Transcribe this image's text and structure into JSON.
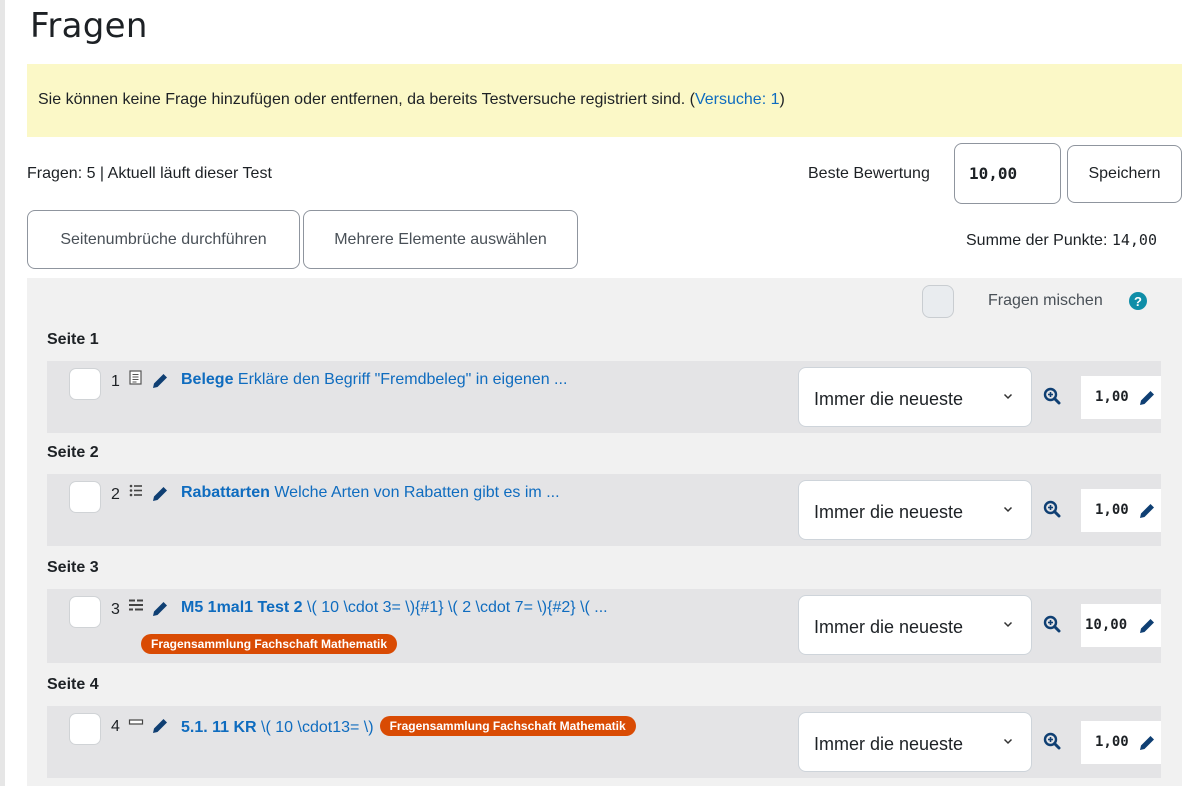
{
  "page": {
    "title": "Fragen"
  },
  "alert": {
    "text": "Sie können keine Frage hinzufügen oder entfernen, da bereits Testversuche registriert sind. (",
    "link": "Versuche: 1",
    "end": ")"
  },
  "status": "Fragen: 5 | Aktuell läuft dieser Test",
  "best_grade": {
    "label": "Beste Bewertung",
    "value": "10,00",
    "save_label": "Speichern"
  },
  "buttons": {
    "repaginate": "Seitenumbrüche durchführen",
    "multiselect": "Mehrere Elemente auswählen"
  },
  "total": {
    "label": "Summe der Punkte: ",
    "value": "14,00"
  },
  "shuffle": {
    "label": "Fragen mischen",
    "help": "?"
  },
  "pages": [
    {
      "label": "Seite 1",
      "slot": {
        "number": "1",
        "icon": "essay-question-icon",
        "name": "Belege",
        "text": " Erkläre den Begriff \"Fremdbeleg\" in eigenen ...",
        "tag": "",
        "version": "Immer die neueste",
        "mark": "1,00"
      }
    },
    {
      "label": "Seite 2",
      "slot": {
        "number": "2",
        "icon": "multichoice-question-icon",
        "name": "Rabattarten",
        "text": " Welche Arten von Rabatten gibt es im ...",
        "tag": "",
        "version": "Immer die neueste",
        "mark": "1,00"
      }
    },
    {
      "label": "Seite 3",
      "slot": {
        "number": "3",
        "icon": "cloze-question-icon",
        "name": "M5 1mal1 Test 2",
        "text": " \\( 10 \\cdot 3= \\){#1} \\( 2 \\cdot 7= \\){#2} \\( ...",
        "tag": "Fragensammlung Fachschaft Mathematik",
        "version": "Immer die neueste",
        "mark": "10,00"
      }
    },
    {
      "label": "Seite 4",
      "slot": {
        "number": "4",
        "icon": "shortanswer-question-icon",
        "name": "5.1. 11 KR",
        "text": " \\( 10 \\cdot13= \\)",
        "tag": "Fragensammlung Fachschaft Mathematik",
        "version": "Immer die neueste",
        "mark": "1,00"
      }
    }
  ],
  "colors": {
    "link": "#0f6cbf",
    "tag": "#d94b04",
    "alert": "#fbf8c7",
    "help": "#0f8ea8"
  }
}
